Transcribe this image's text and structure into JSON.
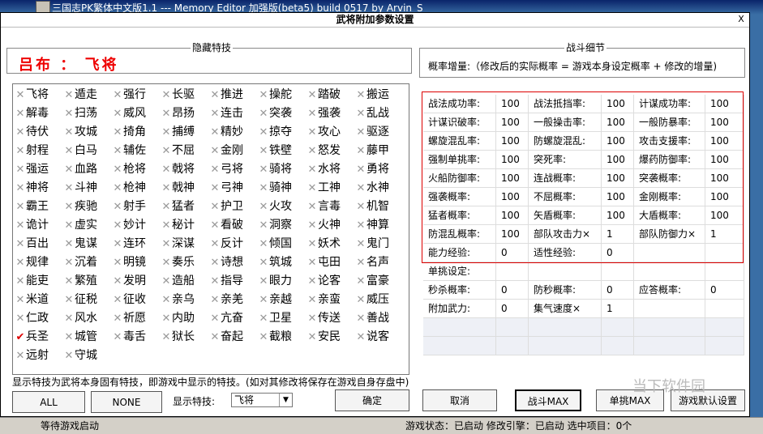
{
  "window": {
    "title": "三国志PK繁体中文版1.1 --- Memory Editor 加强版(beta5) build 0517 by Arvin_S",
    "dialog_title": "武将附加参数设置",
    "close": "X"
  },
  "hidden": {
    "group_label": "隐藏特技",
    "hero_name": "吕布 ：",
    "hero_skill": "飞将",
    "skills": [
      [
        "飞将",
        "遁走",
        "强行",
        "长驱",
        "推进",
        "操舵",
        "踏破",
        "搬运"
      ],
      [
        "解毒",
        "扫荡",
        "威风",
        "昂扬",
        "连击",
        "突袭",
        "强袭",
        "乱战"
      ],
      [
        "待伏",
        "攻城",
        "掎角",
        "捕缚",
        "精妙",
        "掠夺",
        "攻心",
        "驱逐"
      ],
      [
        "射程",
        "白马",
        "辅佐",
        "不屈",
        "金刚",
        "铁壁",
        "怒发",
        "藤甲"
      ],
      [
        "强运",
        "血路",
        "枪将",
        "戟将",
        "弓将",
        "骑将",
        "水将",
        "勇将"
      ],
      [
        "神将",
        "斗神",
        "枪神",
        "戟神",
        "弓神",
        "骑神",
        "工神",
        "水神"
      ],
      [
        "霸王",
        "疾驰",
        "射手",
        "猛者",
        "护卫",
        "火攻",
        "言毒",
        "机智"
      ],
      [
        "诡计",
        "虚实",
        "妙计",
        "秘计",
        "看破",
        "洞察",
        "火神",
        "神算"
      ],
      [
        "百出",
        "鬼谋",
        "连环",
        "深谋",
        "反计",
        "倾国",
        "妖术",
        "鬼门"
      ],
      [
        "规律",
        "沉着",
        "明镜",
        "奏乐",
        "诗想",
        "筑城",
        "屯田",
        "名声"
      ],
      [
        "能吏",
        "繁殖",
        "发明",
        "造船",
        "指导",
        "眼力",
        "论客",
        "富豪"
      ],
      [
        "米道",
        "征税",
        "征收",
        "亲乌",
        "亲羌",
        "亲越",
        "亲蛮",
        "威压"
      ],
      [
        "仁政",
        "风水",
        "祈愿",
        "内助",
        "亢奋",
        "卫星",
        "传送",
        "善战"
      ],
      [
        "兵圣",
        "城管",
        "毒舌",
        "狱长",
        "奋起",
        "截粮",
        "安民",
        "说客"
      ],
      [
        "远射",
        "守城",
        "",
        "",
        "",
        "",
        "",
        ""
      ]
    ],
    "checked": "✔",
    "unchecked": "✕"
  },
  "battle": {
    "group_label": "战斗细节",
    "note": "概率增量:（修改后的实际概率 = 游戏本身设定概率 + 修改的增量)",
    "rows": [
      [
        "战法成功率:",
        "100",
        "战法抵挡率:",
        "100",
        "计谋成功率:",
        "100"
      ],
      [
        "计谋识破率:",
        "100",
        "一般操击率:",
        "100",
        "一般防暴率:",
        "100"
      ],
      [
        "螺旋混乱率:",
        "100",
        "防螺旋混乱:",
        "100",
        "攻击支援率:",
        "100"
      ],
      [
        "强制单挑率:",
        "100",
        "突死率:",
        "100",
        "爆药防御率:",
        "100"
      ],
      [
        "火船防御率:",
        "100",
        "连战概率:",
        "100",
        "突袭概率:",
        "100"
      ],
      [
        "强袭概率:",
        "100",
        "不屈概率:",
        "100",
        "金刚概率:",
        "100"
      ],
      [
        "猛者概率:",
        "100",
        "矢盾概率:",
        "100",
        "大盾概率:",
        "100"
      ],
      [
        "防混乱概率:",
        "100",
        "部队攻击力×",
        "1",
        "部队防御力×",
        "1"
      ],
      [
        "能力经验:",
        "0",
        "适性经验:",
        "0",
        "",
        ""
      ],
      [
        "单挑设定:",
        "",
        "",
        "",
        "",
        ""
      ],
      [
        "秒杀概率:",
        "0",
        "防秒概率:",
        "0",
        "应答概率:",
        "0"
      ],
      [
        "附加武力:",
        "0",
        "集气速度×",
        "1",
        "",
        ""
      ]
    ]
  },
  "footer": {
    "hint": "显示特技为武将本身固有特技，即游戏中显示的特技。(如对其修改将保存在游戏自身存盘中)",
    "all": "ALL",
    "none": "NONE",
    "display_label": "显示特技:",
    "display_value": "飞将",
    "confirm": "确定",
    "cancel": "取消",
    "battle_max": "战斗MAX",
    "duel_max": "单挑MAX",
    "default": "游戏默认设置"
  },
  "status": {
    "left": "等待游戏启动",
    "right": "游戏状态：已启动  修改引擎：已启动  选中项目：0个"
  },
  "watermark": "当下软件园"
}
